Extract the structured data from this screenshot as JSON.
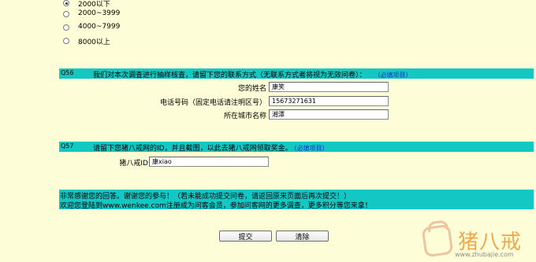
{
  "income_options": [
    {
      "label": "2000以下",
      "checked": true
    },
    {
      "label": "2000~3999",
      "checked": false
    },
    {
      "label": "4000~7999",
      "checked": false
    },
    {
      "label": "8000以上",
      "checked": false
    }
  ],
  "q56": {
    "number": "Q56",
    "text": "我们对本次调查进行抽样核查，请留下您的联系方式（无联系方式者将视为无效问卷）：",
    "required": "（必填项目）",
    "fields": {
      "name_label": "您的姓名",
      "name_value": "康笑",
      "phone_label": "电话号码（固定电话请注明区号）",
      "phone_value": "15673271631",
      "city_label": "所在城市名称",
      "city_value": "湘潭"
    }
  },
  "q57": {
    "number": "Q57",
    "text": "请留下您猪八戒网的ID，并且截图，以此去猪八戒网领取奖金。",
    "required": "（必填项目）",
    "id_label": "猪八戒ID",
    "id_value": "康xiao"
  },
  "footer": {
    "line1": "非常感谢您的回答。谢谢您的参与！（若未能成功提交问卷，请返回原来页面后再次提交！）",
    "line2": "欢迎您登陆到www.wenkee.com注册成为问客会员，参加问客网的更多调查，更多积分等您来拿！"
  },
  "buttons": {
    "submit": "提交",
    "reset": "清除"
  },
  "watermark": {
    "text": "猪八戒",
    "url": "www.zhubajie.com"
  }
}
